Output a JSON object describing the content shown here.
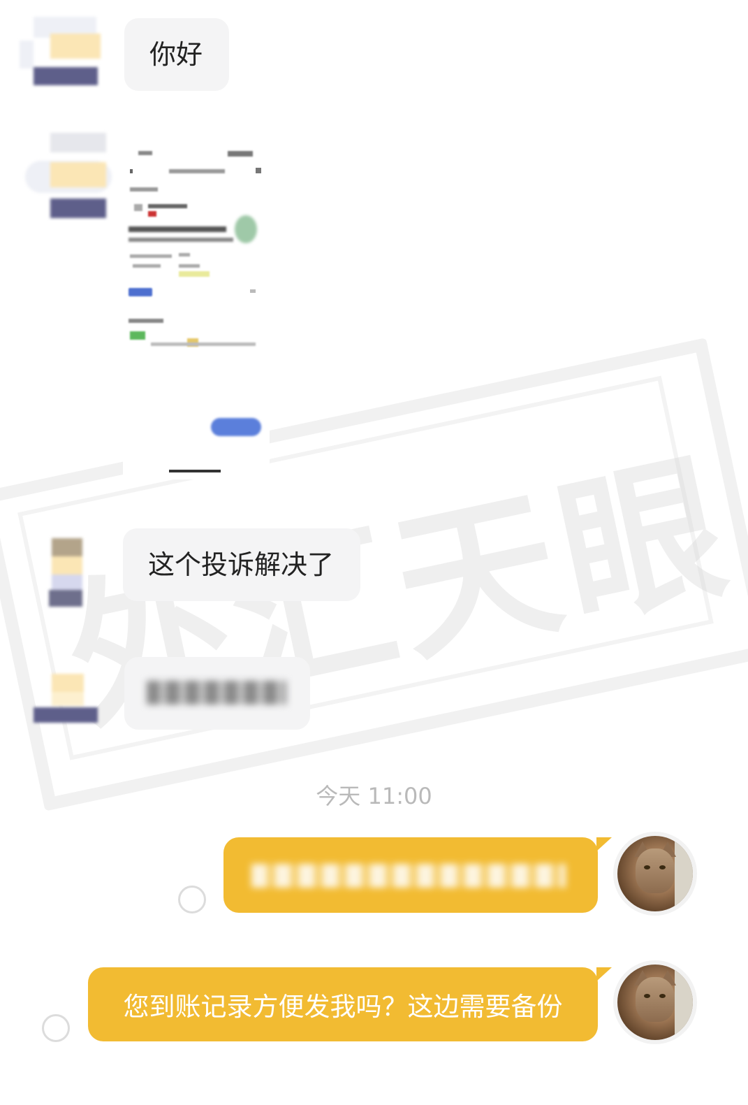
{
  "messages": {
    "m1": {
      "text": "你好"
    },
    "m3": {
      "text": "这个投诉解决了"
    }
  },
  "timestamp": "今天 11:00",
  "outgoing": {
    "m6": {
      "text": "您到账记录方便发我吗？这边需要备份"
    }
  },
  "watermark": {
    "text": "外汇天眼"
  },
  "colors": {
    "outgoing_bubble": "#f2bb32",
    "incoming_bubble": "#f4f4f5",
    "timestamp": "#b9b9b9"
  }
}
